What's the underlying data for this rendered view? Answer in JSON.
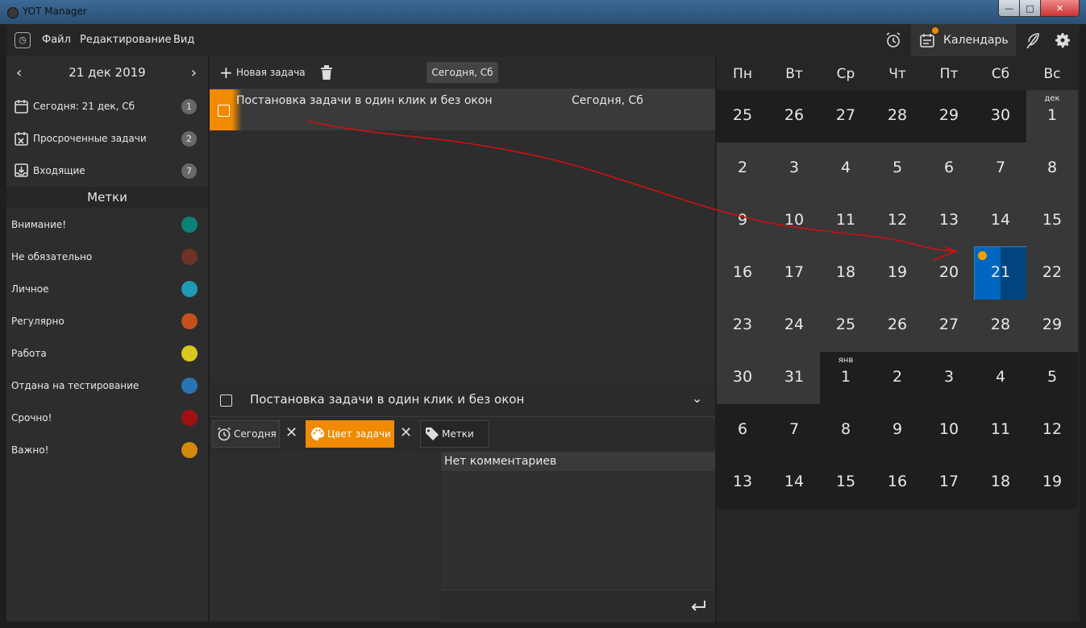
{
  "window": {
    "title": "YOT Manager",
    "min": "—",
    "max": "□",
    "close": "✕"
  },
  "menu": {
    "file": "Файл",
    "edit": "Редактирование",
    "view": "Вид"
  },
  "toolbar_right": {
    "calendar_label": "Календарь",
    "icons": [
      "alarm-clock-icon",
      "calendar-icon",
      "feather-icon",
      "gear-icon"
    ]
  },
  "sidebar": {
    "date_label": "21 дек 2019",
    "prev": "‹",
    "next": "›",
    "nav": [
      {
        "label": "Сегодня: 21 дек, Сб",
        "count": "1",
        "icon": "calendar-today-icon"
      },
      {
        "label": "Просроченные задачи",
        "count": "2",
        "icon": "calendar-overdue-icon"
      },
      {
        "label": "Входящие",
        "count": "7",
        "icon": "inbox-icon"
      }
    ],
    "tags_header": "Метки",
    "tags": [
      {
        "label": "Внимание!",
        "color": "#0f8078"
      },
      {
        "label": "Не обязательно",
        "color": "#6e3326"
      },
      {
        "label": "Личное",
        "color": "#1e9ab4"
      },
      {
        "label": "Регулярно",
        "color": "#c4501c"
      },
      {
        "label": "Работа",
        "color": "#d8c81e"
      },
      {
        "label": "Отдана на тестирование",
        "color": "#2a74b4"
      },
      {
        "label": "Срочно!",
        "color": "#a01212"
      },
      {
        "label": "Важно!",
        "color": "#d4880c"
      }
    ]
  },
  "tasks": {
    "new_task": "Новая задача",
    "today_chip": "Сегодня, Сб",
    "items": [
      {
        "title": "Постановка задачи в один клик и без окон",
        "date": "Сегодня, Сб",
        "color": "#f08a00"
      }
    ]
  },
  "detail": {
    "title": "Постановка задачи в один клик и без окон",
    "today": "Сегодня",
    "color": "Цвет задачи",
    "tags": "Метки",
    "comments_header": "Нет комментариев"
  },
  "calendar": {
    "weekdays": [
      "Пн",
      "Вт",
      "Ср",
      "Чт",
      "Пт",
      "Сб",
      "Вс"
    ],
    "selected": "21",
    "weeks": [
      [
        {
          "d": "25",
          "s": "dim"
        },
        {
          "d": "26",
          "s": "dim"
        },
        {
          "d": "27",
          "s": "dim"
        },
        {
          "d": "28",
          "s": "dim"
        },
        {
          "d": "29",
          "s": "dim"
        },
        {
          "d": "30",
          "s": "dim"
        },
        {
          "d": "1",
          "s": "cur",
          "m": "дек"
        }
      ],
      [
        {
          "d": "2",
          "s": "cur"
        },
        {
          "d": "3",
          "s": "cur"
        },
        {
          "d": "4",
          "s": "cur"
        },
        {
          "d": "5",
          "s": "cur"
        },
        {
          "d": "6",
          "s": "cur"
        },
        {
          "d": "7",
          "s": "cur"
        },
        {
          "d": "8",
          "s": "cur"
        }
      ],
      [
        {
          "d": "9",
          "s": "cur"
        },
        {
          "d": "10",
          "s": "cur"
        },
        {
          "d": "11",
          "s": "cur"
        },
        {
          "d": "12",
          "s": "cur"
        },
        {
          "d": "13",
          "s": "cur"
        },
        {
          "d": "14",
          "s": "cur"
        },
        {
          "d": "15",
          "s": "cur"
        }
      ],
      [
        {
          "d": "16",
          "s": "cur"
        },
        {
          "d": "17",
          "s": "cur"
        },
        {
          "d": "18",
          "s": "cur"
        },
        {
          "d": "19",
          "s": "cur"
        },
        {
          "d": "20",
          "s": "cur"
        },
        {
          "d": "21",
          "s": "sel"
        },
        {
          "d": "22",
          "s": "cur"
        }
      ],
      [
        {
          "d": "23",
          "s": "cur"
        },
        {
          "d": "24",
          "s": "cur"
        },
        {
          "d": "25",
          "s": "cur"
        },
        {
          "d": "26",
          "s": "cur"
        },
        {
          "d": "27",
          "s": "cur"
        },
        {
          "d": "28",
          "s": "cur"
        },
        {
          "d": "29",
          "s": "cur"
        }
      ],
      [
        {
          "d": "30",
          "s": "cur"
        },
        {
          "d": "31",
          "s": "cur"
        },
        {
          "d": "1",
          "s": "dim",
          "m": "янв"
        },
        {
          "d": "2",
          "s": "dim"
        },
        {
          "d": "3",
          "s": "dim"
        },
        {
          "d": "4",
          "s": "dim"
        },
        {
          "d": "5",
          "s": "dim"
        }
      ],
      [
        {
          "d": "6",
          "s": "dim"
        },
        {
          "d": "7",
          "s": "dim"
        },
        {
          "d": "8",
          "s": "dim"
        },
        {
          "d": "9",
          "s": "dim"
        },
        {
          "d": "10",
          "s": "dim"
        },
        {
          "d": "11",
          "s": "dim"
        },
        {
          "d": "12",
          "s": "dim"
        }
      ],
      [
        {
          "d": "13",
          "s": "dim"
        },
        {
          "d": "14",
          "s": "dim"
        },
        {
          "d": "15",
          "s": "dim"
        },
        {
          "d": "16",
          "s": "dim"
        },
        {
          "d": "17",
          "s": "dim"
        },
        {
          "d": "18",
          "s": "dim"
        },
        {
          "d": "19",
          "s": "dim"
        }
      ]
    ]
  },
  "colors": {
    "accent": "#f08a00",
    "selected_day": "#0066c0",
    "annotation": "#d01010"
  }
}
